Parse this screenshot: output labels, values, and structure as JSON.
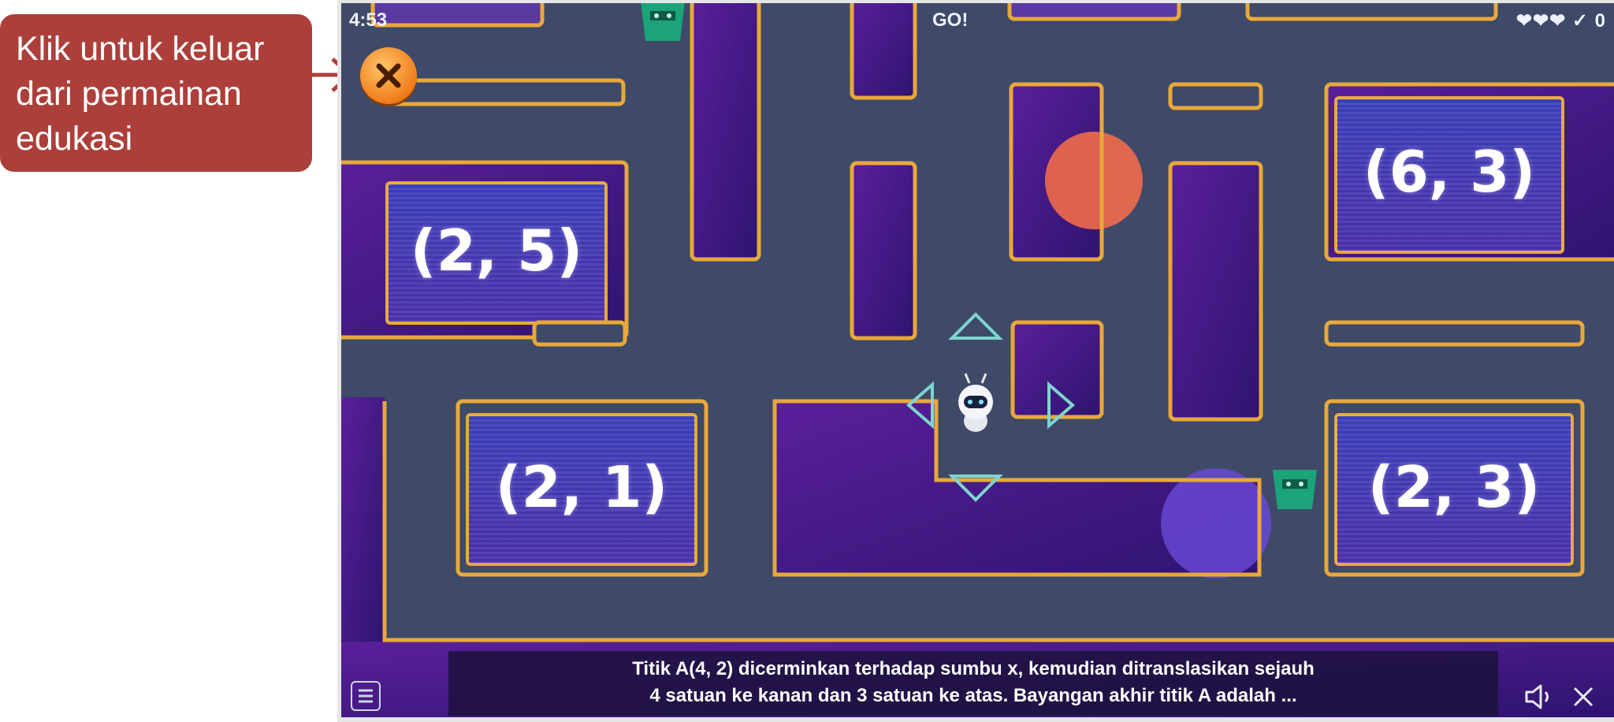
{
  "callout": {
    "line1": "Klik untuk keluar",
    "line2": "dari permainan",
    "line3": "edukasi"
  },
  "hud": {
    "timer": "4:53",
    "status": "GO!",
    "lives": "❤❤❤ ✓ 0"
  },
  "answers": [
    {
      "label": "(2, 5)"
    },
    {
      "label": "(6, 3)"
    },
    {
      "label": "(2, 1)"
    },
    {
      "label": "(2, 3)"
    }
  ],
  "question": {
    "line1": "Titik A(4, 2) dicerminkan terhadap sumbu x, kemudian ditranslasikan sejauh",
    "line2": "4 satuan ke kanan dan 3 satuan ke atas. Bayangan akhir titik A adalah ..."
  },
  "icons": {
    "exit": "close-x-icon",
    "menu": "menu-icon",
    "sound": "speaker-icon",
    "close": "close-icon",
    "player": "robot-icon",
    "enemy": "alien-icon"
  },
  "colors": {
    "callout": "#ad3f3a",
    "floor": "#3e4a67",
    "wall_border": "#e8a83a",
    "wall_fill": "#4a1a86",
    "exit_button": "#f07c1a"
  }
}
